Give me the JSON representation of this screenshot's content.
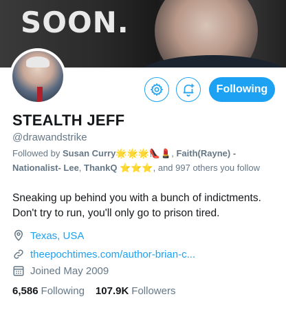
{
  "banner": {
    "text": "SOON."
  },
  "actions": {
    "follow_label": "Following"
  },
  "profile": {
    "name": "STEALTH JEFF",
    "handle": "@drawandstrike",
    "followed_by_prefix": "Followed by",
    "follower_1": "Susan Curry",
    "follower_1_emoji": "🌟🌟🌟👠💄",
    "follower_2": "Faith(Rayne) - Nationalist- Lee",
    "follower_3": "ThankQ",
    "follower_3_emoji": "⭐⭐⭐",
    "followed_by_suffix": ", and 997 others you follow",
    "bio": "Sneaking up behind you with a bunch of indictments. Don't try to run, you'll only go to prison tired.",
    "location": "Texas, USA",
    "website": "theepochtimes.com/author-brian-c...",
    "joined": "Joined May 2009"
  },
  "stats": {
    "following_count": "6,586",
    "following_label": "Following",
    "followers_count": "107.9K",
    "followers_label": "Followers"
  },
  "colors": {
    "accent": "#1da1f2",
    "secondary_text": "#657786",
    "primary_text": "#14171a"
  },
  "icons": [
    "settings-gear-icon",
    "notification-bell-plus-icon",
    "location-pin-icon",
    "link-icon",
    "calendar-icon"
  ]
}
